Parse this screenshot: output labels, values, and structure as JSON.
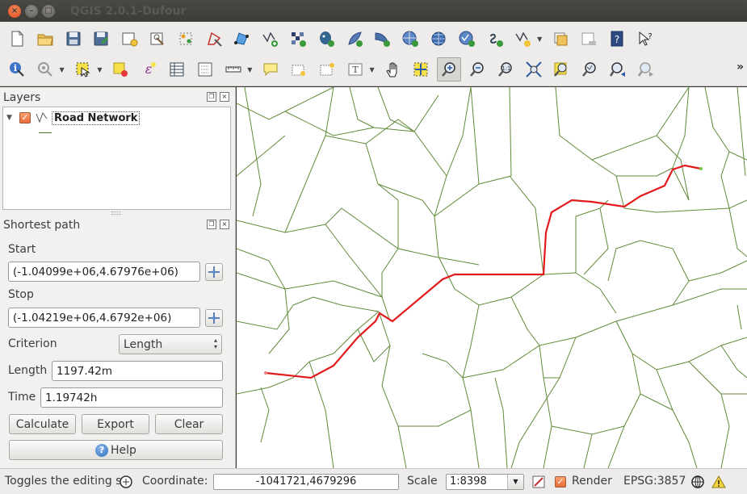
{
  "window": {
    "title": "QGIS 2.0.1-Dufour"
  },
  "toolbar": {
    "more_label": "»",
    "row1": [
      "new-project-icon",
      "open-project-icon",
      "save-project-icon",
      "save-as-icon",
      "new-print-composer-icon",
      "composer-manager-icon",
      "toggle-editing-icon",
      "digitize-icon",
      "move-feature-icon",
      "add-vector-layer-icon",
      "add-raster-layer-icon",
      "add-postgis-layer-icon",
      "add-spatialite-layer-icon",
      "add-mssql-layer-icon",
      "add-wms-layer-icon",
      "add-wcs-layer-icon",
      "add-wfs-layer-icon",
      "add-delimited-text-icon",
      "new-shapefile-icon",
      "add-group-icon",
      "remove-layer-icon",
      "help-icon",
      "whats-this-icon"
    ],
    "row2": [
      "identify-icon",
      "measure-icon",
      "select-icon",
      "deselect-icon",
      "select-expression-icon",
      "attribute-table-icon",
      "statistics-icon",
      "measure-line-icon",
      "annotation-icon",
      "text-annotation-icon",
      "form-annotation-icon",
      "svg-annotation-icon",
      "pan-icon",
      "pan-to-selection-icon",
      "zoom-in-icon",
      "zoom-out-icon",
      "zoom-native-icon",
      "zoom-full-icon",
      "zoom-to-selection-icon",
      "zoom-to-layer-icon",
      "zoom-last-icon",
      "zoom-next-icon"
    ]
  },
  "layers_panel": {
    "title": "Layers",
    "layer_name": "Road Network",
    "layer_checked": true
  },
  "shortest_path": {
    "title": "Shortest path",
    "start_label": "Start",
    "start_value": "(-1.04099e+06,4.67976e+06)",
    "stop_label": "Stop",
    "stop_value": "(-1.04219e+06,4.6792e+06)",
    "criterion_label": "Criterion",
    "criterion_value": "Length",
    "length_label": "Length",
    "length_value": "1197.42m",
    "time_label": "Time",
    "time_value": "1.19742h",
    "calculate_label": "Calculate",
    "export_label": "Export",
    "clear_label": "Clear",
    "help_label": "Help"
  },
  "statusbar": {
    "message": "Toggles the editing s",
    "coordinate_label": "Coordinate:",
    "coordinate_value": "-1041721,4679296",
    "scale_label": "Scale",
    "scale_value": "1:8398",
    "render_label": "Render",
    "render_checked": true,
    "crs": "EPSG:3857"
  },
  "colors": {
    "road": "#5f8a37",
    "route": "#e31a1c",
    "accent": "#e96c37"
  }
}
